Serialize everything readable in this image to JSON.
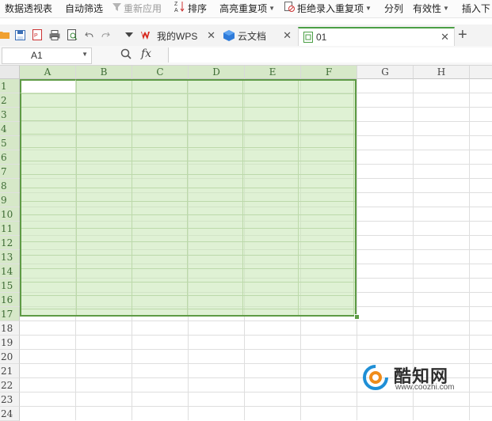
{
  "ribbon": {
    "items": [
      {
        "label": "数据透视表",
        "disabled": false
      },
      {
        "label": "自动筛选",
        "disabled": false
      },
      {
        "label": "重新应用",
        "disabled": true
      },
      {
        "label": "排序",
        "disabled": false
      },
      {
        "label": "高亮重复项",
        "disabled": false
      },
      {
        "label": "拒绝录入重复项",
        "disabled": false
      },
      {
        "label": "分列",
        "disabled": false
      },
      {
        "label": "有效性",
        "disabled": false
      },
      {
        "label": "插入下"
      }
    ]
  },
  "tabs": [
    {
      "label": "我的WPS",
      "icon": "wps-logo-icon"
    },
    {
      "label": "云文档",
      "icon": "cloud-docs-icon"
    },
    {
      "label": "01",
      "icon": "spreadsheet-file-icon",
      "active": true
    }
  ],
  "formula_bar": {
    "cell_ref": "A1",
    "fx_label": "fx",
    "formula": ""
  },
  "grid": {
    "columns": [
      "A",
      "B",
      "C",
      "D",
      "E",
      "F",
      "G",
      "H"
    ],
    "rows": [
      "1",
      "2",
      "3",
      "4",
      "5",
      "6",
      "7",
      "8",
      "9",
      "10",
      "11",
      "12",
      "13",
      "14",
      "15",
      "16",
      "17",
      "18",
      "19",
      "20",
      "21",
      "22",
      "23",
      "24"
    ],
    "selection": "A1:F17",
    "active_cell": "A1"
  },
  "watermark": {
    "name": "酷知网",
    "url": "www.coozhi.com"
  },
  "colors": {
    "selection_fill": "#cce9ba",
    "selection_border": "#5e9b45",
    "tab_accent": "#4b9f45",
    "wps_red": "#d7291e"
  }
}
